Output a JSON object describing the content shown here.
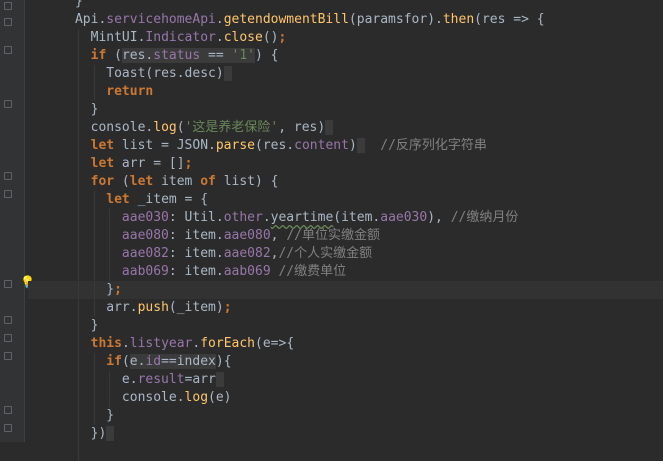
{
  "lines": [
    {
      "indent": 3,
      "tokens": [
        {
          "t": "}",
          "c": "plain"
        }
      ]
    },
    {
      "indent": 3,
      "tokens": [
        {
          "t": "Api",
          "c": "plain"
        },
        {
          "t": ".",
          "c": "plain"
        },
        {
          "t": "servicehomeApi",
          "c": "prop"
        },
        {
          "t": ".",
          "c": "plain"
        },
        {
          "t": "getendowmentBill",
          "c": "fn"
        },
        {
          "t": "(paramsfor).",
          "c": "plain"
        },
        {
          "t": "then",
          "c": "fn"
        },
        {
          "t": "(res => {",
          "c": "plain"
        }
      ]
    },
    {
      "indent": 4,
      "tokens": [
        {
          "t": "MintUI",
          "c": "plain"
        },
        {
          "t": ".",
          "c": "plain"
        },
        {
          "t": "Indicator",
          "c": "prop"
        },
        {
          "t": ".",
          "c": "plain"
        },
        {
          "t": "close",
          "c": "fn"
        },
        {
          "t": "()",
          "c": "plain"
        },
        {
          "t": ";",
          "c": "kw"
        }
      ]
    },
    {
      "indent": 4,
      "tokens": [
        {
          "t": "if",
          "c": "kw"
        },
        {
          "t": " (",
          "c": "plain"
        },
        {
          "t": "res.",
          "c": "hl"
        },
        {
          "t": "status",
          "c": "prop hl"
        },
        {
          "t": " == ",
          "c": "plain hl"
        },
        {
          "t": "'1'",
          "c": "str hl"
        },
        {
          "t": ") {",
          "c": "plain"
        }
      ]
    },
    {
      "indent": 5,
      "tokens": [
        {
          "t": "Toast",
          "c": "plain"
        },
        {
          "t": "(res.desc)",
          "c": "plain"
        },
        {
          "t": " ",
          "c": "hl"
        }
      ]
    },
    {
      "indent": 5,
      "tokens": [
        {
          "t": "return",
          "c": "kw"
        }
      ]
    },
    {
      "indent": 4,
      "tokens": [
        {
          "t": "}",
          "c": "plain"
        }
      ]
    },
    {
      "indent": 4,
      "tokens": [
        {
          "t": "console",
          "c": "plain"
        },
        {
          "t": ".",
          "c": "plain"
        },
        {
          "t": "log",
          "c": "fn"
        },
        {
          "t": "(",
          "c": "plain"
        },
        {
          "t": "'这是养老保险'",
          "c": "str"
        },
        {
          "t": ", res)",
          "c": "plain"
        },
        {
          "t": " ",
          "c": "hl"
        }
      ]
    },
    {
      "indent": 4,
      "tokens": [
        {
          "t": "let",
          "c": "kw"
        },
        {
          "t": " list = JSON.",
          "c": "plain"
        },
        {
          "t": "parse",
          "c": "fn"
        },
        {
          "t": "(res.",
          "c": "plain"
        },
        {
          "t": "content",
          "c": "prop"
        },
        {
          "t": ")",
          "c": "plain"
        },
        {
          "t": " ",
          "c": "hl"
        },
        {
          "t": "  ",
          "c": "plain"
        },
        {
          "t": "//反序列化字符串",
          "c": "cm"
        }
      ]
    },
    {
      "indent": 4,
      "tokens": [
        {
          "t": "let",
          "c": "kw"
        },
        {
          "t": " arr = []",
          "c": "plain"
        },
        {
          "t": ";",
          "c": "kw"
        }
      ]
    },
    {
      "indent": 4,
      "tokens": [
        {
          "t": "for",
          "c": "kw"
        },
        {
          "t": " (",
          "c": "plain"
        },
        {
          "t": "let",
          "c": "kw"
        },
        {
          "t": " item ",
          "c": "plain"
        },
        {
          "t": "of",
          "c": "kw"
        },
        {
          "t": " list) {",
          "c": "plain"
        }
      ]
    },
    {
      "indent": 5,
      "tokens": [
        {
          "t": "let",
          "c": "kw"
        },
        {
          "t": " _item = {",
          "c": "plain"
        }
      ]
    },
    {
      "indent": 6,
      "tokens": [
        {
          "t": "aae030",
          "c": "prop"
        },
        {
          "t": ": Util.",
          "c": "plain"
        },
        {
          "t": "other",
          "c": "prop"
        },
        {
          "t": ".",
          "c": "plain"
        },
        {
          "t": "yeartime",
          "c": "plain squig"
        },
        {
          "t": "(item.",
          "c": "plain"
        },
        {
          "t": "aae030",
          "c": "prop"
        },
        {
          "t": "), ",
          "c": "plain"
        },
        {
          "t": "//缴纳月份",
          "c": "cm"
        }
      ]
    },
    {
      "indent": 6,
      "tokens": [
        {
          "t": "aae080",
          "c": "prop"
        },
        {
          "t": ": item.",
          "c": "plain"
        },
        {
          "t": "aae080",
          "c": "prop"
        },
        {
          "t": ", ",
          "c": "plain"
        },
        {
          "t": "//单位实缴金额",
          "c": "cm"
        }
      ]
    },
    {
      "indent": 6,
      "tokens": [
        {
          "t": "aae082",
          "c": "prop"
        },
        {
          "t": ": item.",
          "c": "plain"
        },
        {
          "t": "aae082",
          "c": "prop"
        },
        {
          "t": ",",
          "c": "plain"
        },
        {
          "t": "//个人实缴金额",
          "c": "cm"
        }
      ]
    },
    {
      "indent": 6,
      "tokens": [
        {
          "t": "aab069",
          "c": "prop"
        },
        {
          "t": ": item.",
          "c": "plain"
        },
        {
          "t": "aab069",
          "c": "prop"
        },
        {
          "t": " ",
          "c": "plain"
        },
        {
          "t": "//缴费单位",
          "c": "cm"
        }
      ]
    },
    {
      "indent": 5,
      "current": true,
      "tokens": [
        {
          "t": "}",
          "c": "plain"
        },
        {
          "t": ";",
          "c": "kw"
        }
      ]
    },
    {
      "indent": 5,
      "tokens": [
        {
          "t": "arr.",
          "c": "plain"
        },
        {
          "t": "push",
          "c": "fn"
        },
        {
          "t": "(_item)",
          "c": "plain"
        },
        {
          "t": ";",
          "c": "kw"
        }
      ]
    },
    {
      "indent": 4,
      "tokens": [
        {
          "t": "}",
          "c": "plain"
        }
      ]
    },
    {
      "indent": 4,
      "tokens": [
        {
          "t": "this",
          "c": "kw"
        },
        {
          "t": ".",
          "c": "plain"
        },
        {
          "t": "listyear",
          "c": "prop"
        },
        {
          "t": ".",
          "c": "plain"
        },
        {
          "t": "forEach",
          "c": "fn"
        },
        {
          "t": "(e=>{",
          "c": "plain"
        }
      ]
    },
    {
      "indent": 5,
      "tokens": [
        {
          "t": "if",
          "c": "kw"
        },
        {
          "t": "(",
          "c": "plain"
        },
        {
          "t": "e.",
          "c": "plain hl"
        },
        {
          "t": "id",
          "c": "prop hl"
        },
        {
          "t": "==index",
          "c": "plain hl"
        },
        {
          "t": "){",
          "c": "plain"
        }
      ]
    },
    {
      "indent": 6,
      "tokens": [
        {
          "t": "e.",
          "c": "plain"
        },
        {
          "t": "result",
          "c": "prop"
        },
        {
          "t": "=arr",
          "c": "plain"
        },
        {
          "t": " ",
          "c": "hl"
        }
      ]
    },
    {
      "indent": 6,
      "tokens": [
        {
          "t": "console",
          "c": "plain"
        },
        {
          "t": ".",
          "c": "plain"
        },
        {
          "t": "log",
          "c": "fn"
        },
        {
          "t": "(e)",
          "c": "plain"
        }
      ]
    },
    {
      "indent": 5,
      "tokens": [
        {
          "t": "}",
          "c": "plain"
        }
      ]
    },
    {
      "indent": 4,
      "tokens": [
        {
          "t": "})",
          "c": "plain"
        },
        {
          "t": " ",
          "c": "hl"
        }
      ]
    },
    {
      "indent": 4,
      "tokens": [
        {
          "t": "",
          "c": "plain"
        }
      ]
    }
  ]
}
